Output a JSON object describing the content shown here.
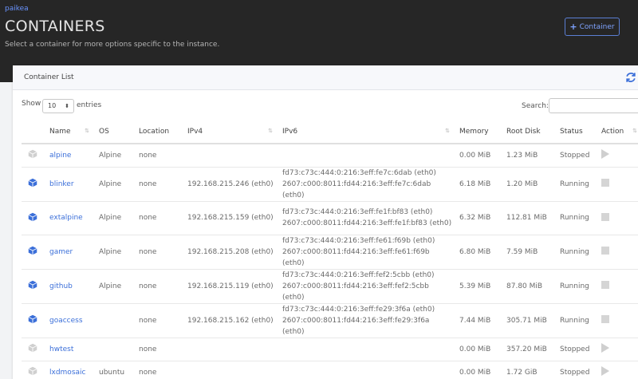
{
  "header": {
    "breadcrumb": "paikea",
    "title": "CONTAINERS",
    "subtitle": "Select a container for more options specific to the instance.",
    "add_button_icon": "plus-icon",
    "add_button_label": "Container"
  },
  "card": {
    "title": "Container List",
    "refresh_icon": "refresh-icon"
  },
  "controls": {
    "show_label": "Show",
    "entries_value": "10",
    "entries_label": "entries",
    "search_label": "Search:",
    "search_value": ""
  },
  "columns": [
    "Name",
    "OS",
    "Location",
    "IPv4",
    "IPv6",
    "Memory",
    "Root Disk",
    "Status",
    "Action"
  ],
  "rows": [
    {
      "icon": "cube-icon",
      "active": false,
      "name": "alpine",
      "os": "Alpine",
      "location": "none",
      "ipv4": "",
      "ipv6_1": "",
      "ipv6_2": "",
      "memory": "0.00 MiB",
      "disk": "1.23 MiB",
      "status": "Stopped",
      "action": "play-icon"
    },
    {
      "icon": "cube-icon",
      "active": true,
      "name": "blinker",
      "os": "Alpine",
      "location": "none",
      "ipv4": "192.168.215.246 (eth0)",
      "ipv6_1": "fd73:c73c:444:0:216:3eff:fe7c:6dab (eth0)",
      "ipv6_2": "2607:c000:8011:fd44:216:3eff:fe7c:6dab (eth0)",
      "memory": "6.18 MiB",
      "disk": "1.20 MiB",
      "status": "Running",
      "action": "stop-icon"
    },
    {
      "icon": "cube-icon",
      "active": true,
      "name": "extalpine",
      "os": "Alpine",
      "location": "none",
      "ipv4": "192.168.215.159 (eth0)",
      "ipv6_1": "fd73:c73c:444:0:216:3eff:fe1f:bf83 (eth0)",
      "ipv6_2": "2607:c000:8011:fd44:216:3eff:fe1f:bf83 (eth0)",
      "memory": "6.32 MiB",
      "disk": "112.81 MiB",
      "status": "Running",
      "action": "stop-icon"
    },
    {
      "icon": "cube-icon",
      "active": true,
      "name": "gamer",
      "os": "Alpine",
      "location": "none",
      "ipv4": "192.168.215.208 (eth0)",
      "ipv6_1": "fd73:c73c:444:0:216:3eff:fe61:f69b (eth0)",
      "ipv6_2": "2607:c000:8011:fd44:216:3eff:fe61:f69b (eth0)",
      "memory": "6.80 MiB",
      "disk": "7.59 MiB",
      "status": "Running",
      "action": "stop-icon"
    },
    {
      "icon": "cube-icon",
      "active": true,
      "name": "github",
      "os": "Alpine",
      "location": "none",
      "ipv4": "192.168.215.119 (eth0)",
      "ipv6_1": "fd73:c73c:444:0:216:3eff:fef2:5cbb (eth0)",
      "ipv6_2": "2607:c000:8011:fd44:216:3eff:fef2:5cbb (eth0)",
      "memory": "5.39 MiB",
      "disk": "87.80 MiB",
      "status": "Running",
      "action": "stop-icon"
    },
    {
      "icon": "cube-icon",
      "active": true,
      "name": "goaccess",
      "os": "",
      "location": "none",
      "ipv4": "192.168.215.162 (eth0)",
      "ipv6_1": "fd73:c73c:444:0:216:3eff:fe29:3f6a (eth0)",
      "ipv6_2": "2607:c000:8011:fd44:216:3eff:fe29:3f6a (eth0)",
      "memory": "7.44 MiB",
      "disk": "305.71 MiB",
      "status": "Running",
      "action": "stop-icon"
    },
    {
      "icon": "cube-icon",
      "active": false,
      "name": "hwtest",
      "os": "",
      "location": "none",
      "ipv4": "",
      "ipv6_1": "",
      "ipv6_2": "",
      "memory": "0.00 MiB",
      "disk": "357.20 MiB",
      "status": "Stopped",
      "action": "play-icon"
    },
    {
      "icon": "cube-icon",
      "active": false,
      "name": "lxdmosaic",
      "os": "ubuntu",
      "location": "none",
      "ipv4": "",
      "ipv6_1": "",
      "ipv6_2": "",
      "memory": "0.00 MiB",
      "disk": "1.72 GiB",
      "status": "Stopped",
      "action": "play-icon"
    }
  ],
  "colors": {
    "accent": "#3b6fd9",
    "header_bg": "#262626",
    "inactive_icon": "#cfcfcf"
  }
}
